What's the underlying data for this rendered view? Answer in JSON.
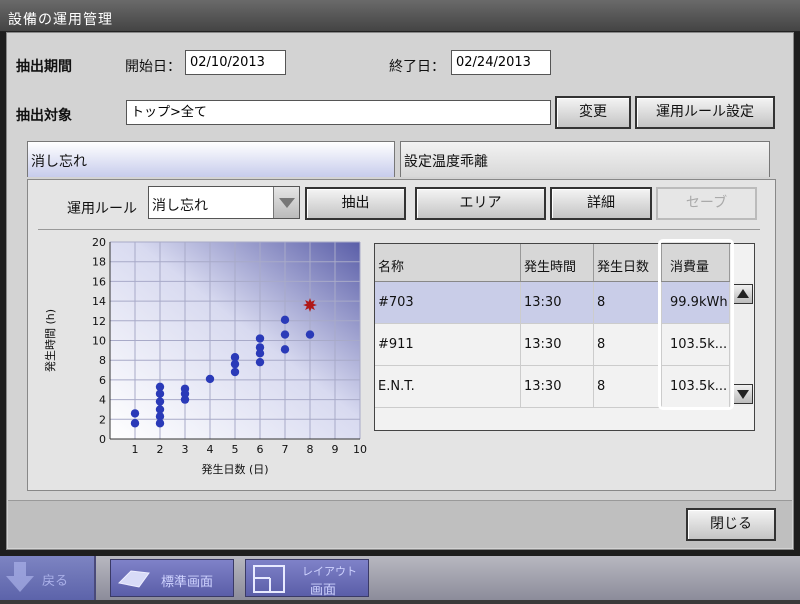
{
  "window": {
    "title": "設備の運用管理"
  },
  "period": {
    "label": "抽出期間",
    "start_label": "開始日：",
    "start_value": "02/10/2013",
    "end_label": "終了日：",
    "end_value": "02/24/2013"
  },
  "target": {
    "label": "抽出対象",
    "value": "トップ>全て",
    "change_label": "変更",
    "rules_label": "運用ルール設定"
  },
  "tabs": [
    {
      "label": "消し忘れ",
      "active": true
    },
    {
      "label": "設定温度乖離",
      "active": false
    }
  ],
  "controls": {
    "rule_label": "運用ルール",
    "rule_value": "消し忘れ",
    "extract_label": "抽出",
    "area_label": "エリア",
    "detail_label": "詳細",
    "save_label": "セーブ"
  },
  "chart_data": {
    "type": "scatter",
    "xlabel": "発生日数 (日)",
    "ylabel": "発生時間 (h)",
    "xlim": [
      0,
      10
    ],
    "ylim": [
      0,
      20
    ],
    "xticks": [
      "1",
      "2",
      "3",
      "4",
      "5",
      "6",
      "7",
      "8",
      "9",
      "10"
    ],
    "yticks": [
      "0",
      "2",
      "4",
      "6",
      "8",
      "10",
      "12",
      "14",
      "16",
      "18",
      "20"
    ],
    "grid": true,
    "series": [
      {
        "color": "#2a3ab8",
        "points": [
          [
            1,
            1.6
          ],
          [
            1,
            2.6
          ],
          [
            2,
            1.6
          ],
          [
            2,
            2.3
          ],
          [
            2,
            3.0
          ],
          [
            2,
            3.8
          ],
          [
            2,
            4.6
          ],
          [
            2,
            5.3
          ],
          [
            3,
            4.0
          ],
          [
            3,
            4.6
          ],
          [
            3,
            5.1
          ],
          [
            4,
            6.1
          ],
          [
            5,
            6.8
          ],
          [
            5,
            7.6
          ],
          [
            5,
            8.3
          ],
          [
            6,
            7.8
          ],
          [
            6,
            8.7
          ],
          [
            6,
            9.3
          ],
          [
            6,
            10.2
          ],
          [
            7,
            9.1
          ],
          [
            7,
            10.6
          ],
          [
            7,
            12.1
          ],
          [
            8,
            10.6
          ]
        ]
      },
      {
        "color": "#b01818",
        "marker": "star",
        "points": [
          [
            8,
            13.6
          ]
        ]
      }
    ]
  },
  "table": {
    "columns": [
      "名称",
      "発生時間",
      "発生日数",
      "消費量"
    ],
    "rows": [
      {
        "name": "#703",
        "time": "13:30",
        "days": "8",
        "usage": "99.9kWh"
      },
      {
        "name": "#911",
        "time": "13:30",
        "days": "8",
        "usage": "103.5k..."
      },
      {
        "name": "E.N.T.",
        "time": "13:30",
        "days": "8",
        "usage": "103.5k..."
      }
    ]
  },
  "footer": {
    "close_label": "閉じる"
  },
  "taskbar": {
    "left_label": "戻る",
    "standard_label": "標準画面",
    "layout_label_1": "レイアウト",
    "layout_label_2": "画面"
  }
}
